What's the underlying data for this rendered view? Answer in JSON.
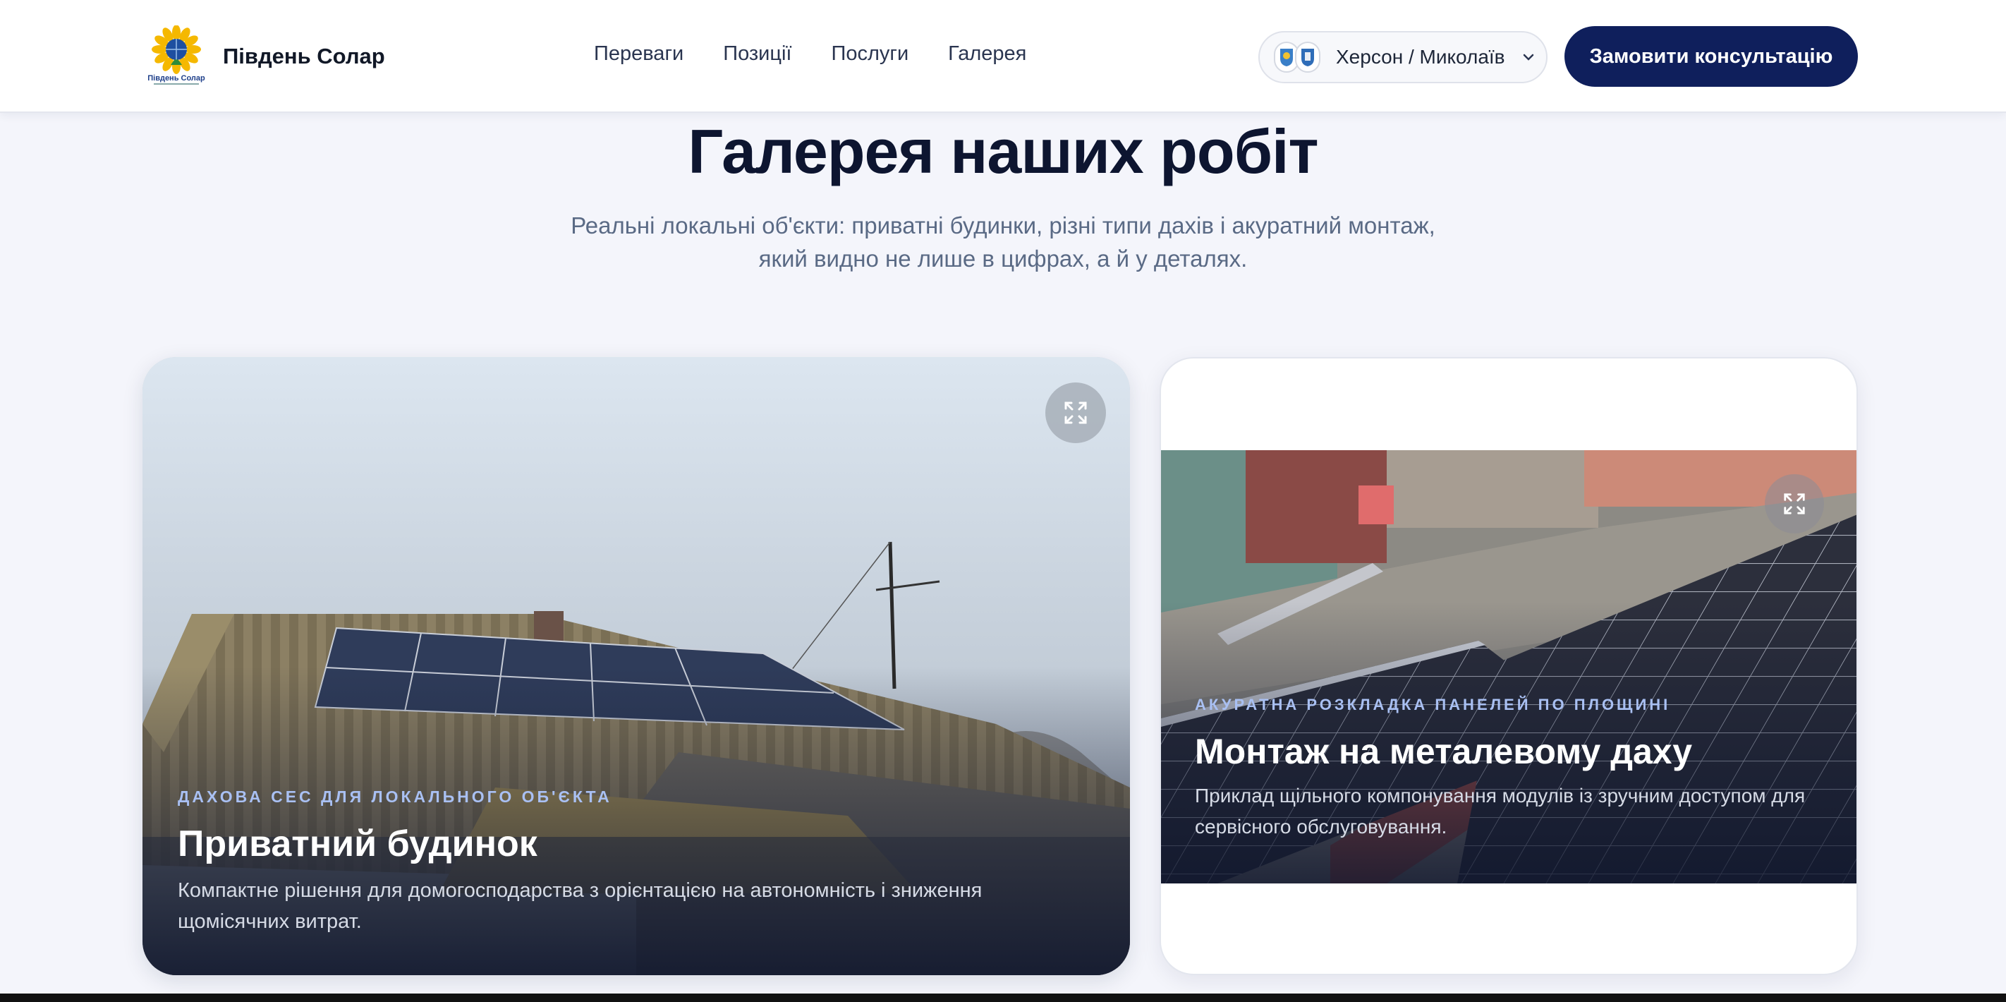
{
  "header": {
    "brand_name": "Південь Солар",
    "logo_caption": "Південь Солар",
    "nav": [
      "Переваги",
      "Позиції",
      "Послуги",
      "Галерея"
    ],
    "region_label": "Херсон / Миколаїв",
    "cta_label": "Замовити консультацію"
  },
  "gallery": {
    "title": "Галерея наших робіт",
    "subtitle_line1": "Реальні локальні об'єкти: приватні будинки, різні типи дахів і акуратний монтаж,",
    "subtitle_line2": "який видно не лише в цифрах, а й у деталях.",
    "cards": [
      {
        "eyebrow": "ДАХОВА СЕС ДЛЯ ЛОКАЛЬНОГО ОБ'ЄКТА",
        "title": "Приватний будинок",
        "description": "Компактне рішення для домогосподарства з орієнтацією на автономність і зниження щомісячних витрат."
      },
      {
        "eyebrow": "АКУРАТНА РОЗКЛАДКА ПАНЕЛЕЙ ПО ПЛОЩИНІ",
        "title": "Монтаж на металевому даху",
        "description": "Приклад щільного компонування модулів із зручним доступом для сервісного обслуговування."
      }
    ]
  },
  "colors": {
    "primary": "#0f1f5c",
    "eyebrow": "#a9c0f3",
    "page_bg": "#f4f5fb"
  }
}
